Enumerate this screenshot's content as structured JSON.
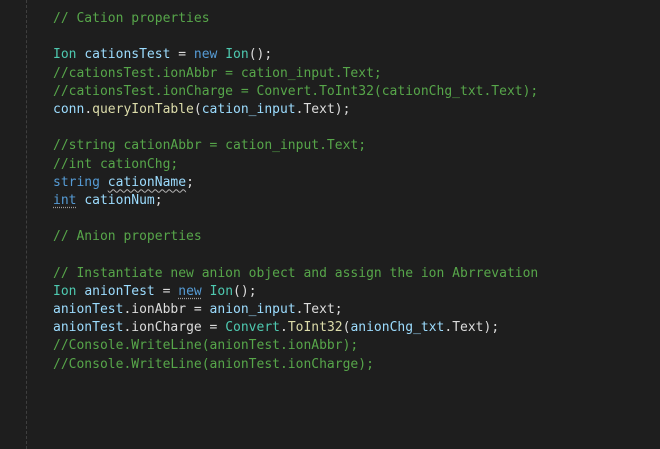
{
  "colors": {
    "background": "#1e1e1e",
    "comment": "#57a64a",
    "keyword": "#569cd6",
    "type": "#4ec9b0",
    "variable": "#9cdcfe",
    "method": "#dcdcaa",
    "plain": "#dcdcdc"
  },
  "lines": [
    [
      {
        "t": "// Cation properties",
        "c": "cmt"
      }
    ],
    [],
    [
      {
        "t": "Ion",
        "c": "typ"
      },
      {
        "t": " ",
        "c": "pl"
      },
      {
        "t": "cationsTest",
        "c": "var"
      },
      {
        "t": " = ",
        "c": "pl"
      },
      {
        "t": "new",
        "c": "kw"
      },
      {
        "t": " ",
        "c": "pl"
      },
      {
        "t": "Ion",
        "c": "typ"
      },
      {
        "t": "();",
        "c": "pl"
      }
    ],
    [
      {
        "t": "//cationsTest.ionAbbr = cation_input.Text;",
        "c": "cmt"
      }
    ],
    [
      {
        "t": "//cationsTest.ionCharge = Convert.ToInt32(cationChg_txt.Text);",
        "c": "cmt"
      }
    ],
    [
      {
        "t": "conn",
        "c": "var"
      },
      {
        "t": ".",
        "c": "pl"
      },
      {
        "t": "queryIonTable",
        "c": "mth"
      },
      {
        "t": "(",
        "c": "pl"
      },
      {
        "t": "cation_input",
        "c": "var"
      },
      {
        "t": ".Text);",
        "c": "pl"
      }
    ],
    [],
    [
      {
        "t": "//string cationAbbr = cation_input.Text;",
        "c": "cmt"
      }
    ],
    [
      {
        "t": "//int cationChg;",
        "c": "cmt"
      }
    ],
    [
      {
        "t": "string",
        "c": "kw"
      },
      {
        "t": " ",
        "c": "pl"
      },
      {
        "t": "cationName",
        "c": "var squiggle"
      },
      {
        "t": ";",
        "c": "pl"
      }
    ],
    [
      {
        "t": "int",
        "c": "kw dots"
      },
      {
        "t": " ",
        "c": "pl"
      },
      {
        "t": "cationNum",
        "c": "var"
      },
      {
        "t": ";",
        "c": "pl"
      }
    ],
    [],
    [
      {
        "t": "// Anion properties",
        "c": "cmt"
      }
    ],
    [],
    [
      {
        "t": "// Instantiate new anion object and assign the ion Abrrevation",
        "c": "cmt"
      }
    ],
    [
      {
        "t": "Ion",
        "c": "typ"
      },
      {
        "t": " ",
        "c": "pl"
      },
      {
        "t": "anionTest",
        "c": "var"
      },
      {
        "t": " = ",
        "c": "pl"
      },
      {
        "t": "new",
        "c": "kw dots"
      },
      {
        "t": " ",
        "c": "pl"
      },
      {
        "t": "Ion",
        "c": "typ"
      },
      {
        "t": "();",
        "c": "pl"
      }
    ],
    [
      {
        "t": "anionTest",
        "c": "var"
      },
      {
        "t": ".ionAbbr = ",
        "c": "pl"
      },
      {
        "t": "anion_input",
        "c": "var"
      },
      {
        "t": ".Text;",
        "c": "pl"
      }
    ],
    [
      {
        "t": "anionTest",
        "c": "var"
      },
      {
        "t": ".ionCharge = ",
        "c": "pl"
      },
      {
        "t": "Convert",
        "c": "cls"
      },
      {
        "t": ".",
        "c": "pl"
      },
      {
        "t": "ToInt32",
        "c": "mth"
      },
      {
        "t": "(",
        "c": "pl"
      },
      {
        "t": "anionChg_txt",
        "c": "var"
      },
      {
        "t": ".Text);",
        "c": "pl"
      }
    ],
    [
      {
        "t": "//Console.WriteLine(anionTest.ionAbbr);",
        "c": "cmt"
      }
    ],
    [
      {
        "t": "//Console.WriteLine(anionTest.ionCharge);",
        "c": "cmt"
      }
    ]
  ]
}
